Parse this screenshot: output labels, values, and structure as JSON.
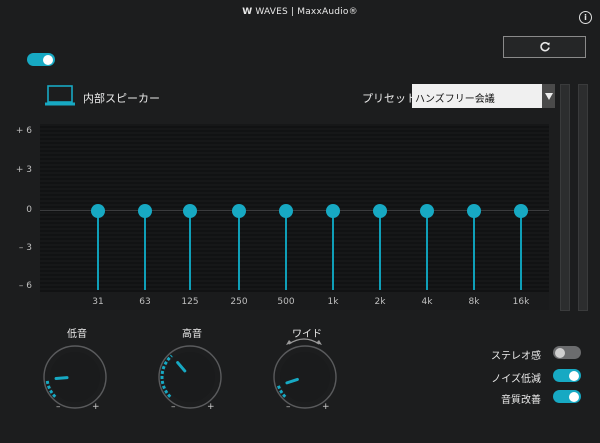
{
  "header": {
    "logo_mark": "W",
    "title": "WAVES | MaxxAudio®",
    "info_symbol": "i"
  },
  "device": {
    "label": "内部スピーカー",
    "enabled": true
  },
  "preset": {
    "label": "プリセット",
    "value": "ハンズフリー会議"
  },
  "eq": {
    "y_labels": [
      "+ 6",
      "+ 3",
      "0",
      "– 3",
      "– 6"
    ],
    "bands": [
      {
        "label": "31",
        "gain": 0
      },
      {
        "label": "63",
        "gain": 0
      },
      {
        "label": "125",
        "gain": 0
      },
      {
        "label": "250",
        "gain": 0
      },
      {
        "label": "500",
        "gain": 0
      },
      {
        "label": "1k",
        "gain": 0
      },
      {
        "label": "2k",
        "gain": 0
      },
      {
        "label": "4k",
        "gain": 0
      },
      {
        "label": "8k",
        "gain": 0
      },
      {
        "label": "16k",
        "gain": 0
      }
    ]
  },
  "knobs": [
    {
      "label": "低音",
      "level": 0.15,
      "minus": "–",
      "plus": "+"
    },
    {
      "label": "高音",
      "level": 0.35,
      "minus": "–",
      "plus": "+"
    },
    {
      "label": "ワイド",
      "level": 0.1,
      "minus": "–",
      "plus": "+"
    }
  ],
  "features": [
    {
      "label": "ステレオ感",
      "enabled": false
    },
    {
      "label": "ノイズ低減",
      "enabled": true
    },
    {
      "label": "音質改善",
      "enabled": true
    }
  ],
  "colors": {
    "accent": "#17a9c3",
    "background": "#1c1d1e"
  },
  "icons": {
    "reset": "refresh-icon",
    "device": "laptop-icon",
    "dropdown": "triangle-down-icon"
  }
}
